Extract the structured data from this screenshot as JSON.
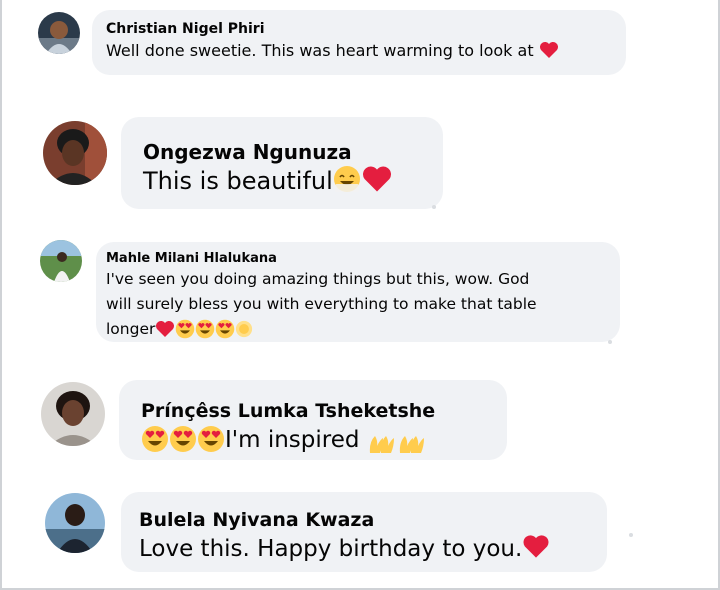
{
  "comments": [
    {
      "author": "Christian Nigel Phiri",
      "text": "Well done sweetie. This was heart warming to look at",
      "emojis": [
        "red-heart"
      ]
    },
    {
      "author": "Ongezwa Ngunuza",
      "text": "This is beautiful",
      "emojis": [
        "smiling-face-with-smiling-eyes",
        "red-heart"
      ]
    },
    {
      "author": "Mahle Milani Hlalukana",
      "text_line1": "I've seen you doing amazing things but this, wow. God",
      "text_line2": "will surely bless you with everything to make that table",
      "text_line3": "longer",
      "emojis": [
        "red-heart",
        "heart-eyes",
        "heart-eyes",
        "heart-eyes",
        "sun"
      ]
    },
    {
      "author": "Prínçêss Lumka Tsheketshe",
      "text": "I'm inspired",
      "emojis": [
        "heart-eyes",
        "heart-eyes",
        "heart-eyes",
        "raising-hands",
        "raising-hands"
      ]
    },
    {
      "author": "Bulela Nyivana Kwaza",
      "text": "Love this. Happy birthday to you.",
      "emojis": [
        "red-heart"
      ]
    }
  ],
  "colors": {
    "bubble": "#f0f2f5",
    "text": "#050505",
    "heart": "#e41e3f",
    "emoji_face": "#ffcc4d"
  }
}
